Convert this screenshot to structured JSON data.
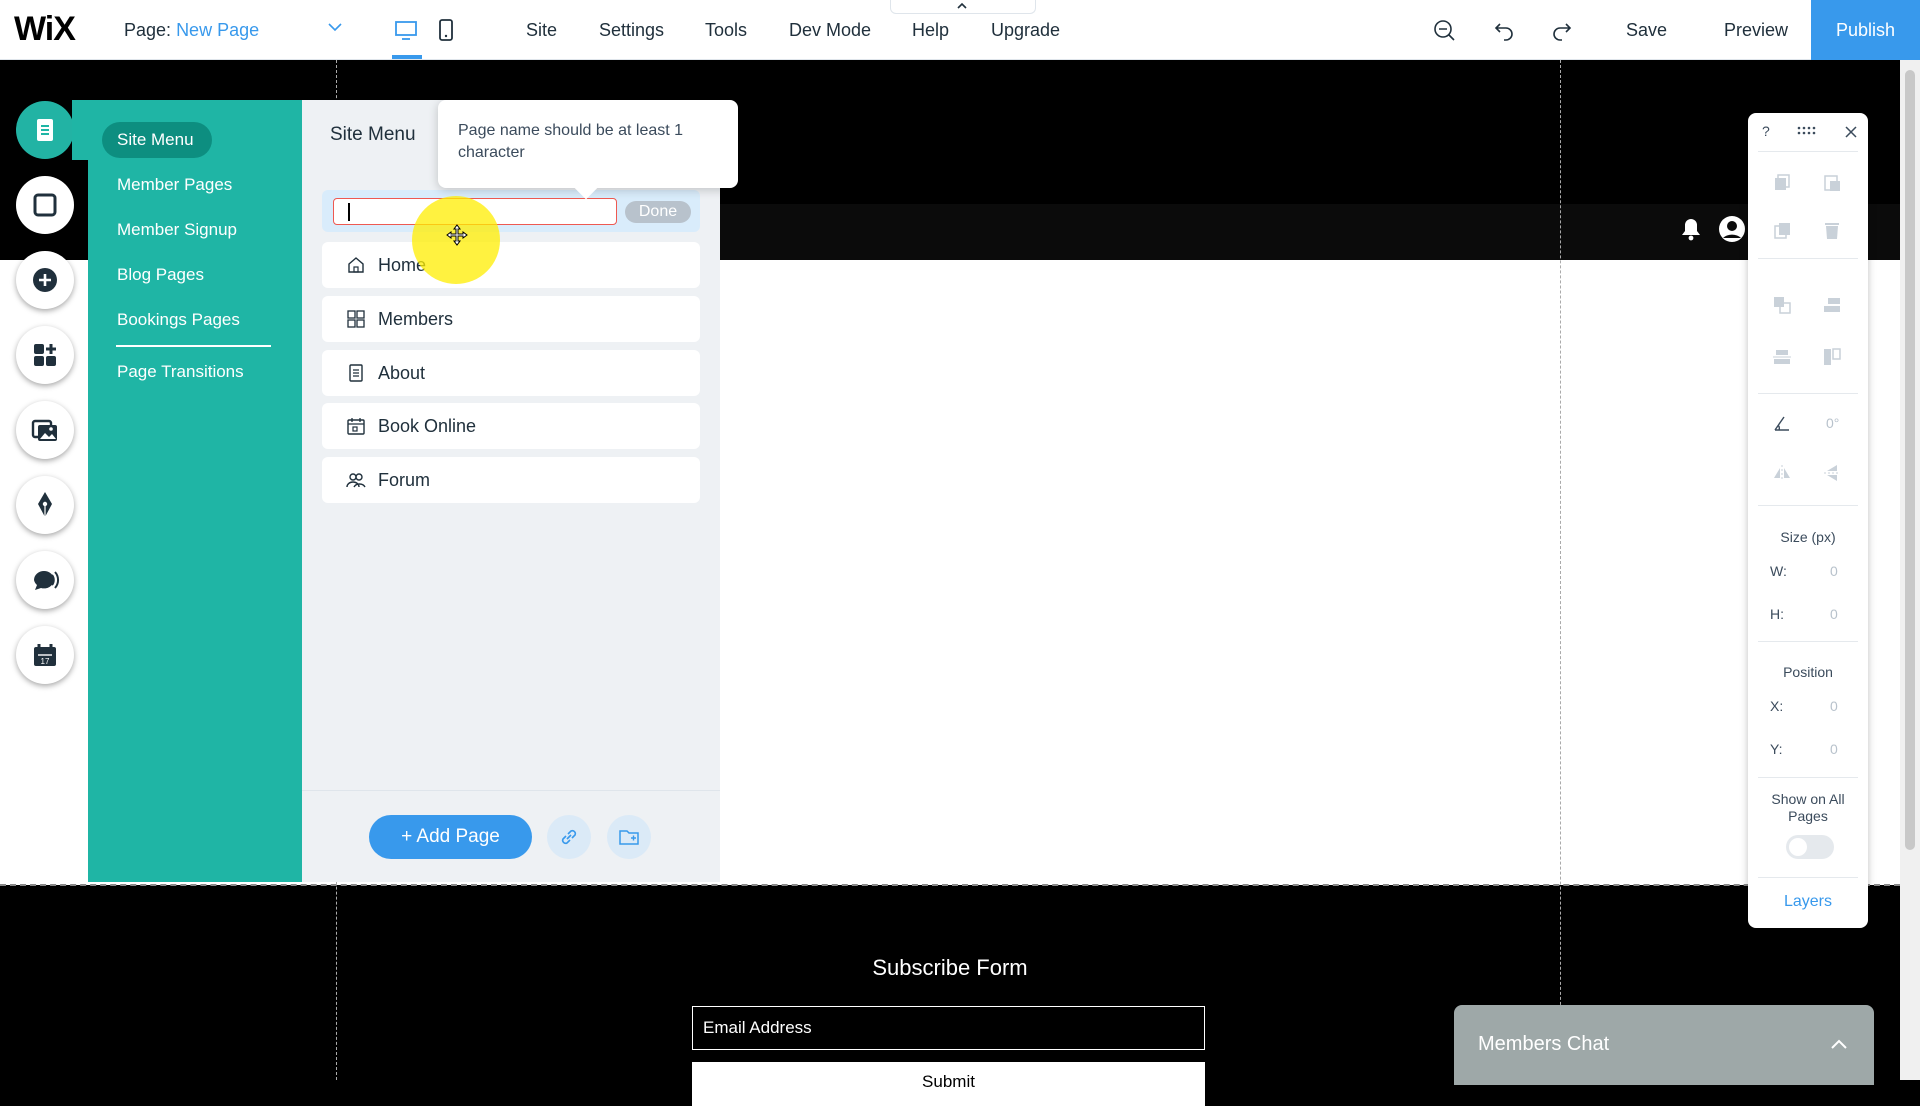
{
  "topbar": {
    "logo": "WiX",
    "page_prefix": "Page:",
    "page_name": "New Page",
    "menu": [
      "Site",
      "Settings",
      "Tools",
      "Dev Mode",
      "Help",
      "Upgrade"
    ],
    "save": "Save",
    "preview": "Preview",
    "publish": "Publish"
  },
  "pages_panel": {
    "tabs": [
      "Site Menu",
      "Member Pages",
      "Member Signup",
      "Blog Pages",
      "Bookings Pages",
      "Page Transitions"
    ],
    "header": "Site Menu",
    "tooltip": "Page name should be at least 1 character",
    "new_page_value": "",
    "done": "Done",
    "pages": [
      {
        "label": "Home",
        "icon": "home-icon"
      },
      {
        "label": "Members",
        "icon": "members-icon"
      },
      {
        "label": "About",
        "icon": "page-icon"
      },
      {
        "label": "Book Online",
        "icon": "calendar-icon"
      },
      {
        "label": "Forum",
        "icon": "forum-icon"
      }
    ],
    "add_page": "+ Add Page"
  },
  "tools_panel": {
    "help": "?",
    "rotation": "0°",
    "size_label": "Size (px)",
    "w_key": "W:",
    "w_val": "0",
    "h_key": "H:",
    "h_val": "0",
    "position_label": "Position",
    "x_key": "X:",
    "x_val": "0",
    "y_key": "Y:",
    "y_val": "0",
    "show_all": "Show on All Pages",
    "layers": "Layers"
  },
  "site": {
    "subscribe_title": "Subscribe Form",
    "email_placeholder": "Email Address",
    "submit": "Submit",
    "chat_title": "Members Chat"
  },
  "colors": {
    "accent": "#3899ec",
    "teal": "#1fb5a5",
    "error": "#ee5951"
  }
}
